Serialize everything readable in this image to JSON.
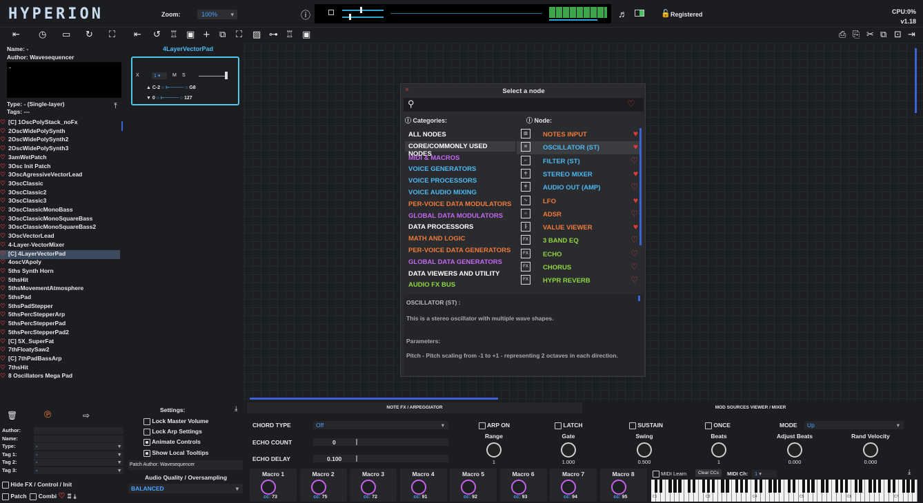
{
  "app": {
    "logo": "HYPERION",
    "zoom_label": "Zoom:",
    "zoom_value": "100%",
    "registered": "Registered",
    "cpu": "CPU:0%",
    "version": "v1.18"
  },
  "patch_info": {
    "name_label": "Name:",
    "name_value": "-",
    "author_label": "Author:",
    "author_value": "Wavesequencer",
    "desc": "-",
    "type_label": "Type:",
    "type_value": "- (Single-layer)",
    "tags_label": "Tags:",
    "tags_value": "---"
  },
  "patches": [
    "[C] 1OscPolyStack_noFx",
    "2OscWidePolySynth",
    "2OscWidePolySynth2",
    "2OscWidePolySynth3",
    "3amWetPatch",
    "3Osc Init Patch",
    "3OscAgressiveVectorLead",
    "3OscClassic",
    "3OscClassic2",
    "3OscClassic3",
    "3OscClassicMonoBass",
    "3OscClassicMonoSquareBass",
    "3OscClassicMonoSquareBass2",
    "3OscVectorLead",
    "4-Layer-VectorMixer",
    "[C] 4LayerVectorPad",
    "4oscVApoly",
    "5ths Synth Horn",
    "5thsHit",
    "5thsMovementAtmosphere",
    "5thsPad",
    "5thsPadStepper",
    "5thsPercStepperArp",
    "5thsPercStepperPad",
    "5thsPercStepperPad2",
    "[C] 5X_SuperFat",
    "7thFloatySaw2",
    "[C] 7thPadBassArp",
    "7thsHit",
    "8 Oscillators Mega Pad"
  ],
  "layer": {
    "title": "4LayerVectorPad",
    "x": "X",
    "num": "1",
    "m": "M",
    "s": "S",
    "low_note": "C-2",
    "high_note": "G8",
    "low_vel": "0",
    "high_vel": "127"
  },
  "filter_form": {
    "author": "Author:",
    "name": "Name:",
    "type": "Type:",
    "type_val": "-",
    "tag1": "Tag 1:",
    "tag1_val": "-",
    "tag2": "Tag 2:",
    "tag2_val": "-",
    "tag3": "Tag 3:",
    "tag3_val": "-",
    "hide_fx": "Hide FX / Control / Init",
    "patch": "Patch",
    "combi": "Combi"
  },
  "settings": {
    "title": "Settings:",
    "lock_master": "Lock Master Volume",
    "lock_arp": "Lock Arp Settings",
    "animate": "Animate Controls",
    "tooltips": "Show Local Tooltips",
    "patch_author_label": "Patch Author:",
    "patch_author": "Wavesequencer",
    "quality_label": "Audio Quality / Oversampling",
    "quality_value": "BALANCED"
  },
  "modal": {
    "title": "Select a node",
    "categories_label": "Categories:",
    "node_label": "Node:",
    "categories": [
      {
        "label": "ALL NODES",
        "color": "#ffffff"
      },
      {
        "label": "CORE/COMMONLY USED NODES",
        "color": "#ffffff"
      },
      {
        "label": "MIDI & MACROS",
        "color": "#c466f0"
      },
      {
        "label": "VOICE GENERATORS",
        "color": "#4fb8f0"
      },
      {
        "label": "VOICE PROCESSORS",
        "color": "#4fb8f0"
      },
      {
        "label": "VOICE AUDIO MIXING",
        "color": "#4fb8f0"
      },
      {
        "label": "PER-VOICE DATA MODULATORS",
        "color": "#f07a3a"
      },
      {
        "label": "GLOBAL DATA MODULATORS",
        "color": "#c466f0"
      },
      {
        "label": "DATA PROCESSORS",
        "color": "#ffffff"
      },
      {
        "label": "MATH AND LOGIC",
        "color": "#f07a3a"
      },
      {
        "label": "PER-VOICE DATA GENERATORS",
        "color": "#f07a3a"
      },
      {
        "label": "GLOBAL DATA GENERATORS",
        "color": "#c466f0"
      },
      {
        "label": "DATA VIEWERS AND UTILITY",
        "color": "#ffffff"
      },
      {
        "label": "AUDIO FX BUS",
        "color": "#8fd640"
      }
    ],
    "nodes": [
      {
        "label": "NOTES INPUT",
        "color": "#f07a3a",
        "fav": true
      },
      {
        "label": "OSCILLATOR (ST)",
        "color": "#4fb8f0",
        "fav": true
      },
      {
        "label": "FILTER (ST)",
        "color": "#4fb8f0",
        "fav": false
      },
      {
        "label": "STEREO MIXER",
        "color": "#4fb8f0",
        "fav": true
      },
      {
        "label": "AUDIO OUT (AMP)",
        "color": "#4fb8f0",
        "fav": false
      },
      {
        "label": "LFO",
        "color": "#f07a3a",
        "fav": true
      },
      {
        "label": "ADSR",
        "color": "#f07a3a",
        "fav": false
      },
      {
        "label": "VALUE VIEWER",
        "color": "#f07a3a",
        "fav": true
      },
      {
        "label": "3 BAND EQ",
        "color": "#8fd640",
        "fav": false
      },
      {
        "label": "ECHO",
        "color": "#8fd640",
        "fav": false
      },
      {
        "label": "CHORUS",
        "color": "#8fd640",
        "fav": false
      },
      {
        "label": "HYPR REVERB",
        "color": "#8fd640",
        "fav": false
      }
    ],
    "desc_title": "OSCILLATOR (ST) :",
    "desc_text": "This is a stereo oscillator with multiple wave shapes.",
    "params_label": "Parameters:",
    "params_text": "Pitch - Pitch scaling from -1 to +1 - representing 2 octaves in each direction."
  },
  "note_fx": {
    "tab": "NOTE FX / ARPEGGIATOR",
    "mod_tab": "MOD SOURCES VIEWER / MIXER",
    "chord_label": "CHORD TYPE",
    "chord_value": "Off",
    "echo_count_label": "ECHO COUNT",
    "echo_count": "0",
    "echo_delay_label": "ECHO DELAY",
    "echo_delay": "0.100",
    "arp_on": "ARP ON",
    "latch": "LATCH",
    "sustain": "SUSTAIN",
    "once": "ONCE",
    "mode_label": "MODE",
    "mode_value": "Up",
    "knobs": [
      {
        "label": "Range",
        "value": "1"
      },
      {
        "label": "Gate",
        "value": "1.000"
      },
      {
        "label": "Swing",
        "value": "0.500"
      },
      {
        "label": "Beats",
        "value": "1"
      },
      {
        "label": "Adjust Beats",
        "value": "0.000"
      },
      {
        "label": "Rand Velocity",
        "value": "0.000"
      }
    ]
  },
  "macros": [
    {
      "label": "Macro 1",
      "cc": "73"
    },
    {
      "label": "Macro 2",
      "cc": "75"
    },
    {
      "label": "Macro 3",
      "cc": "72"
    },
    {
      "label": "Macro 4",
      "cc": "91"
    },
    {
      "label": "Macro 5",
      "cc": "92"
    },
    {
      "label": "Macro 6",
      "cc": "93"
    },
    {
      "label": "Macro 7",
      "cc": "94"
    },
    {
      "label": "Macro 8",
      "cc": "95"
    }
  ],
  "cc_prefix": "cc:",
  "midi": {
    "learn": "MIDI Learn",
    "clear": "Clear CCs",
    "ch_label": "MIDI Ch:",
    "ch_value": "1"
  },
  "keys": [
    "C1",
    "C3",
    "C4",
    "C5",
    "C6",
    "C7"
  ]
}
